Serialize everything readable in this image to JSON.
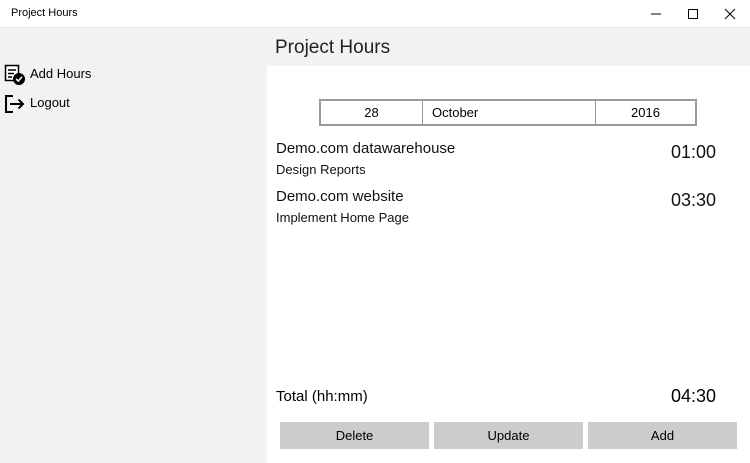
{
  "window": {
    "title": "Project Hours",
    "controls": [
      "minimize",
      "maximize",
      "close"
    ]
  },
  "sidebar": {
    "items": [
      {
        "label": "Add Hours",
        "icon": "add-hours-icon"
      },
      {
        "label": "Logout",
        "icon": "logout-icon"
      }
    ]
  },
  "header": {
    "title": "Project Hours"
  },
  "date": {
    "day": "28",
    "month": "October",
    "year": "2016"
  },
  "entries": [
    {
      "project": "Demo.com datawarehouse",
      "task": "Design Reports",
      "hours": "01:00"
    },
    {
      "project": "Demo.com website",
      "task": "Implement Home Page",
      "hours": "03:30"
    }
  ],
  "total": {
    "label": "Total (hh:mm)",
    "value": "04:30"
  },
  "actions": {
    "delete": "Delete",
    "update": "Update",
    "add": "Add"
  },
  "colors": {
    "sidebar_bg": "#f2f2f2",
    "button_bg": "#cccccc",
    "picker_border": "#9a9a9a"
  }
}
